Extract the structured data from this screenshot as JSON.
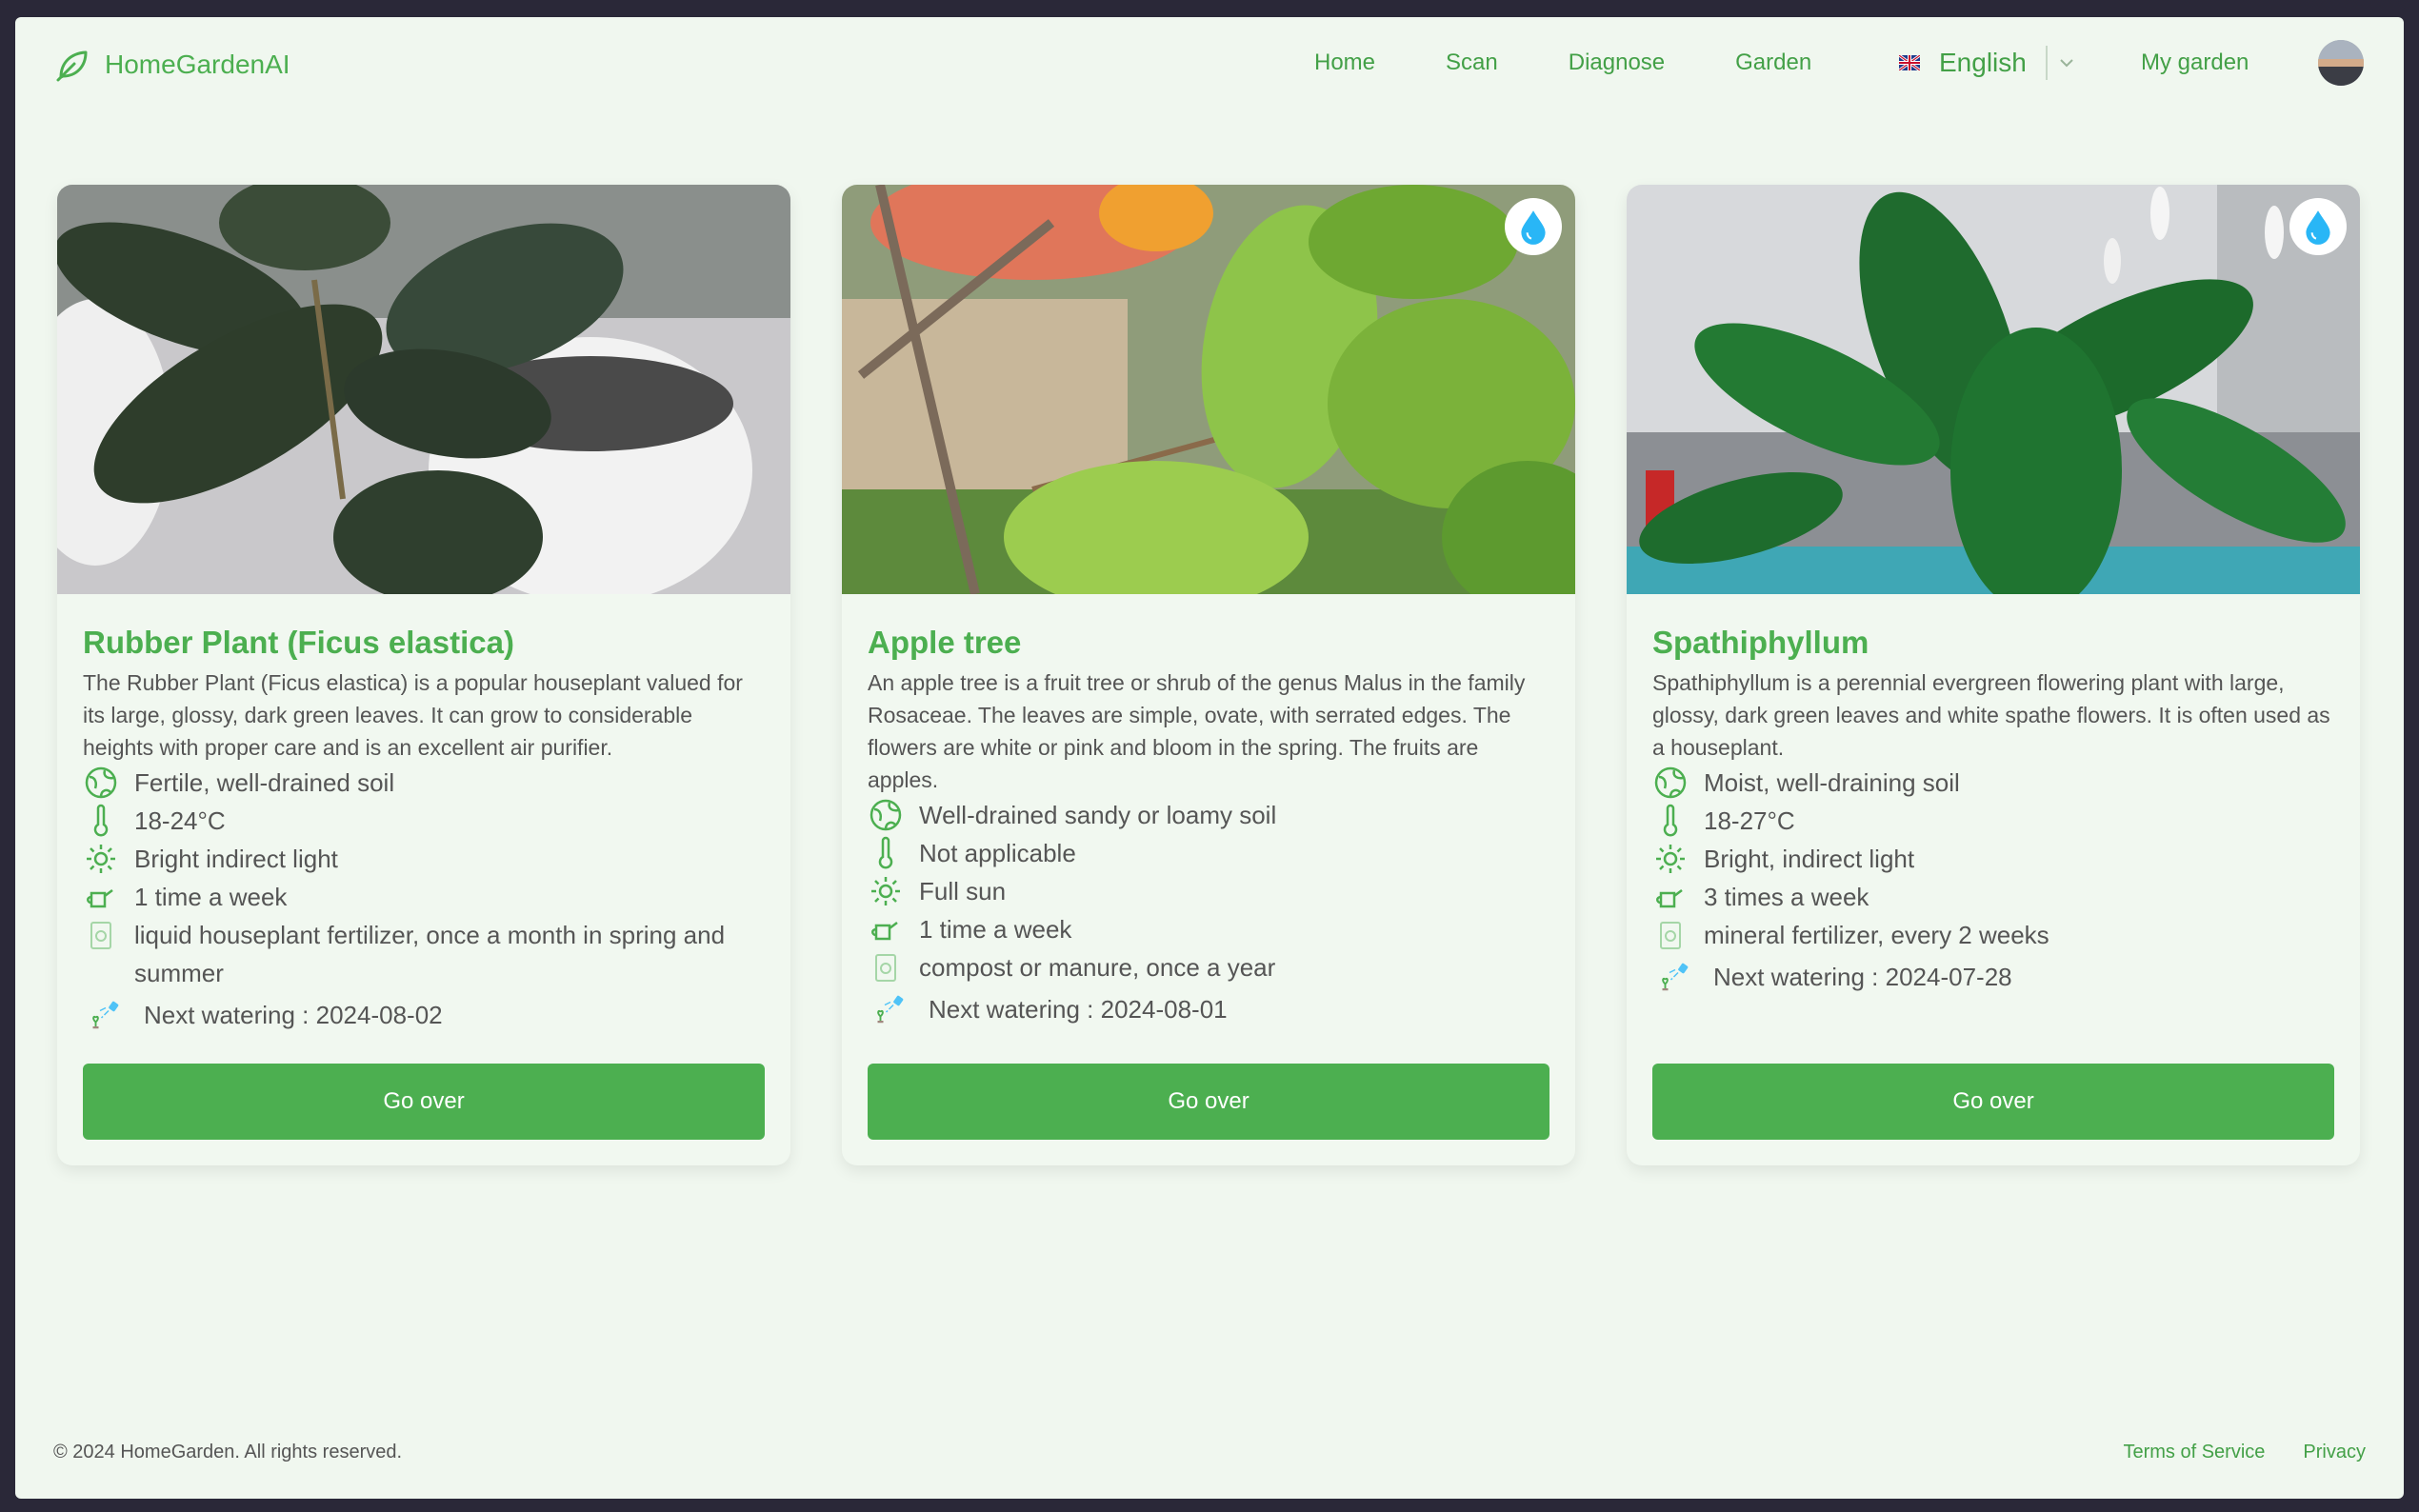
{
  "brand": {
    "name": "HomeGardenAI"
  },
  "nav": {
    "links": [
      "Home",
      "Scan",
      "Diagnose",
      "Garden"
    ],
    "language": "English",
    "my_garden": "My garden"
  },
  "cards": [
    {
      "title": "Rubber Plant (Ficus elastica)",
      "description": "The Rubber Plant (Ficus elastica) is a popular houseplant valued for its large, glossy, dark green leaves. It can grow to considerable heights with proper care and is an excellent air purifier.",
      "soil": "Fertile, well-drained soil",
      "temperature": "18-24°C",
      "light": "Bright indirect light",
      "watering": "1 time a week",
      "fertilizer": "liquid houseplant fertilizer, once a month in spring and summer",
      "next_watering": "Next watering : 2024-08-02",
      "button": "Go over",
      "needs_water_badge": false
    },
    {
      "title": "Apple tree",
      "description": "An apple tree is a fruit tree or shrub of the genus Malus in the family Rosaceae. The leaves are simple, ovate, with serrated edges. The flowers are white or pink and bloom in the spring. The fruits are apples.",
      "soil": "Well-drained sandy or loamy soil",
      "temperature": "Not applicable",
      "light": "Full sun",
      "watering": "1 time a week",
      "fertilizer": "compost or manure, once a year",
      "next_watering": "Next watering : 2024-08-01",
      "button": "Go over",
      "needs_water_badge": true
    },
    {
      "title": "Spathiphyllum",
      "description": "Spathiphyllum is a perennial evergreen flowering plant with large, glossy, dark green leaves and white spathe flowers. It is often used as a houseplant.",
      "soil": "Moist, well-draining soil",
      "temperature": "18-27°C",
      "light": "Bright, indirect light",
      "watering": "3 times a week",
      "fertilizer": "mineral fertilizer, every 2 weeks",
      "next_watering": "Next watering : 2024-07-28",
      "button": "Go over",
      "needs_water_badge": true
    }
  ],
  "footer": {
    "copyright": "© 2024 HomeGarden. All rights reserved.",
    "links": [
      "Terms of Service",
      "Privacy"
    ]
  },
  "colors": {
    "accent": "#4caf50",
    "background": "#f0f7ef",
    "drop": "#29b6f6"
  }
}
